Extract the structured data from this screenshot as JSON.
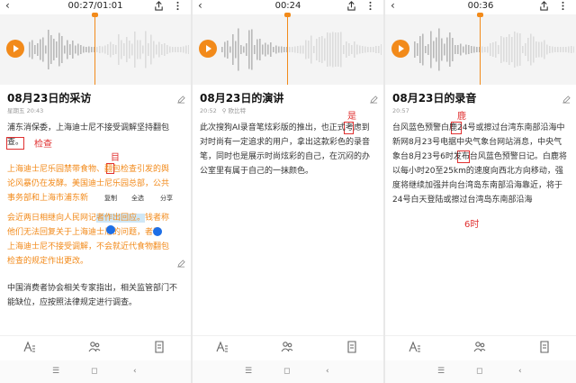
{
  "icons": {
    "back": "chevron-left-icon",
    "share": "share-icon",
    "more": "more-icon",
    "play": "play-icon",
    "edit": "pencil-icon"
  },
  "colors": {
    "accent": "#f28a1a",
    "annotation": "#e03030",
    "selection": "#cfe7f6",
    "handle": "#1e6fe6"
  },
  "panel1": {
    "time": "00:27/01:01",
    "title": "08月23日的采访",
    "date": "星期五 20:43",
    "para1": "浦东消保委，上海迪士尼不接受调解坚持翻包查。",
    "annotation_check": "检查",
    "annotation_mu": "目",
    "orange_lines": [
      "上海迪士尼乐园禁带食物、翻包检查引发的舆",
      "论风暴仍在发酵。美国迪士尼乐园总部，公共",
      "事务部和上海市浦东新",
      "会近两日相继向人民网记",
      "他们无法回复关于上海迪士尼的问题，",
      "上海迪士尼不接受调解，不会就近代食物翻包",
      "检查的规定作出更改。"
    ],
    "highlight1": "者作出回应。",
    "tail1": "钱者称",
    "tail2": "者称",
    "menu": {
      "copy": "复制",
      "select_all": "全选",
      "share": "分享"
    },
    "para3": "中国消费者协会相关专家指出，相关监管部门不能缺位，应按照法律规定进行调查。"
  },
  "panel2": {
    "time": "00:24",
    "title": "08月23日的演讲",
    "date": "20:52",
    "location": "欧比特",
    "para": "此次搜狗AI录音笔炫彩版的推出，也正式考虑到对时尚有一定追求的用户，拿出这款彩色的录音笔，同时也是展示时尚炫彩的自己，在沉闷的办公室里有属于自己的一抹颜色。",
    "annotation_shi": "是"
  },
  "panel3": {
    "time": "00:36",
    "title": "08月23日的录音",
    "date": "20:57",
    "para": "台风蓝色预警白鹿24号或擦过台湾东南部沿海中新网8月23号电据中央气象台网站消息，中央气象台8月23号6时发布台风蓝色预警日记。白鹿将以每小时20至25km的速度向西北方向移动，强度将继续加强并向台湾岛东南部沿海靠近，将于24号白天登陆或擦过台湾岛东南部沿海",
    "annotation_lu": "鹿",
    "annotation_6shi": "6时"
  },
  "navbar": {
    "menu": "☰",
    "home": "◻",
    "back": "‹"
  }
}
